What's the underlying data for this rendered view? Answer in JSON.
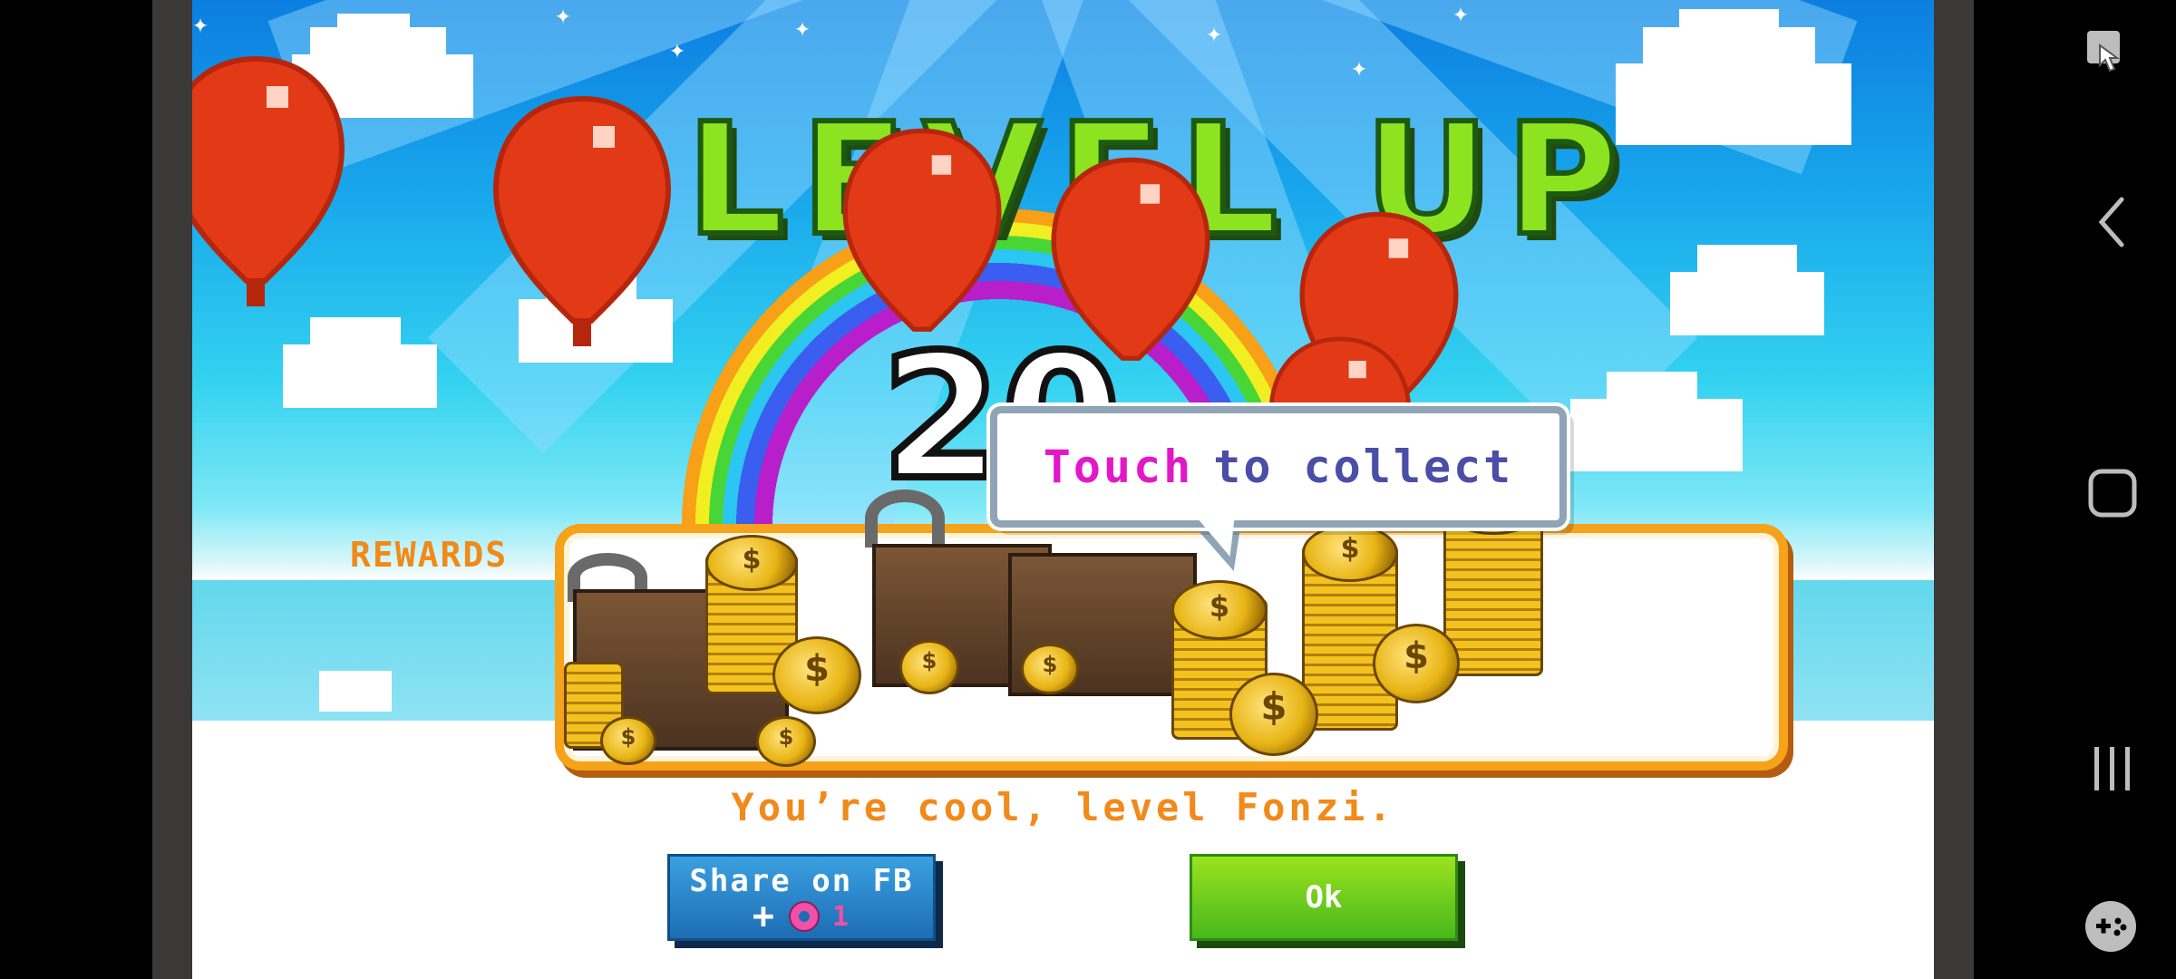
{
  "game": {
    "title": "LEVEL UP",
    "level": "20",
    "rewards_label": "REWARDS",
    "bubble": {
      "highlight": "Touch",
      "rest": "to collect"
    },
    "message": "You’re cool, level Fonzi.",
    "share_button": {
      "label": "Share on FB",
      "bonus_prefix": "+",
      "bonus_icon": "donut-icon",
      "bonus_value": "1"
    },
    "ok_button": {
      "label": "Ok"
    }
  },
  "navbar": {
    "icons": [
      "touch-lock-icon",
      "back-icon",
      "home-icon",
      "recents-icon",
      "game-tools-icon"
    ]
  },
  "colors": {
    "sky": "#19a8ec",
    "title_green": "#8ee320",
    "accent_orange": "#f08a18",
    "fb_blue": "#1d6db4",
    "ok_green": "#6fcd1f",
    "balloon_red": "#e23a16"
  }
}
